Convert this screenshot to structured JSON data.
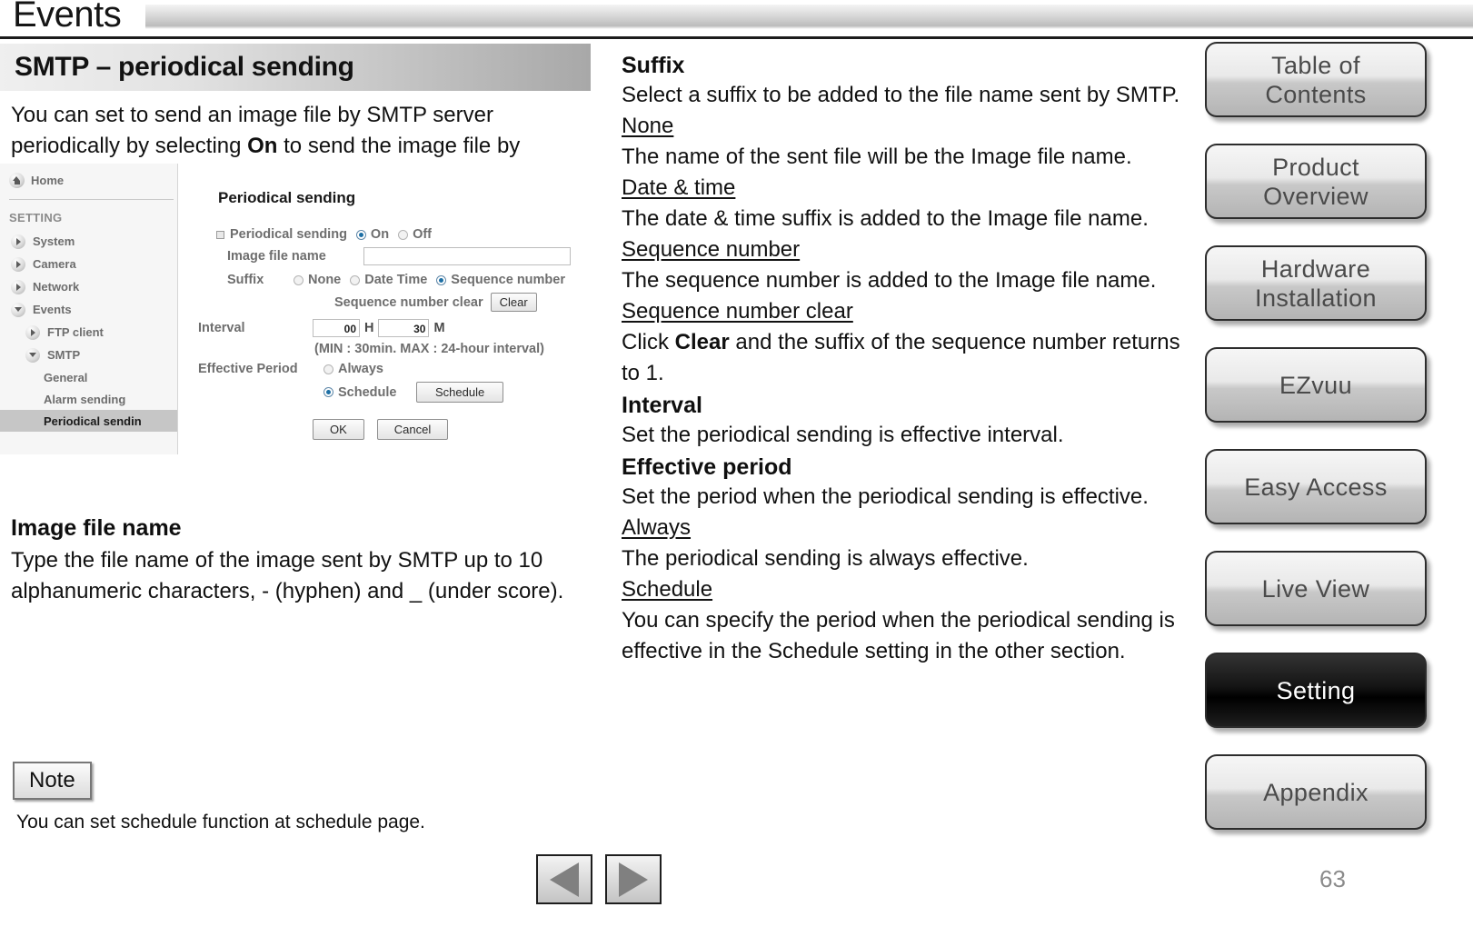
{
  "header": {
    "title": "Events"
  },
  "section": {
    "title": "SMTP – periodical sending",
    "intro_a": "You can set to send an image file by SMTP server periodically by selecting ",
    "intro_b": "On",
    "intro_c": " to send the image file by SMTP server linked with setting period."
  },
  "screenshot": {
    "nav": {
      "home_label": "Home",
      "group_label": "SETTING",
      "items": [
        {
          "label": "System",
          "icon": "chevron-right-icon",
          "level": 1,
          "selected": false
        },
        {
          "label": "Camera",
          "icon": "chevron-right-icon",
          "level": 1,
          "selected": false
        },
        {
          "label": "Network",
          "icon": "chevron-right-icon",
          "level": 1,
          "selected": false
        },
        {
          "label": "Events",
          "icon": "chevron-down-icon",
          "level": 1,
          "selected": false
        },
        {
          "label": "FTP client",
          "icon": "chevron-right-icon",
          "level": 2,
          "selected": false
        },
        {
          "label": "SMTP",
          "icon": "chevron-down-icon",
          "level": 2,
          "selected": false
        },
        {
          "label": "General",
          "icon": "none",
          "level": 3,
          "selected": false
        },
        {
          "label": "Alarm sending",
          "icon": "none",
          "level": 3,
          "selected": false
        },
        {
          "label": "Periodical sendin",
          "icon": "none",
          "level": 3,
          "selected": true
        }
      ]
    },
    "form": {
      "heading": "Periodical sending",
      "periodical_sending_label": "Periodical sending",
      "on_label": "On",
      "off_label": "Off",
      "periodical_sending_value": "On",
      "image_file_name_label": "Image file name",
      "image_file_name_value": "",
      "suffix_label": "Suffix",
      "suffix_none": "None",
      "suffix_datetime": "Date Time",
      "suffix_sequence": "Sequence number",
      "suffix_value": "Sequence number",
      "seq_clear_label": "Sequence number clear",
      "clear_button": "Clear",
      "interval_label": "Interval",
      "interval_hours": "00",
      "interval_hours_unit": "H",
      "interval_minutes": "30",
      "interval_minutes_unit": "M",
      "interval_hint": "(MIN : 30min. MAX : 24-hour interval)",
      "effective_period_label": "Effective Period",
      "always_label": "Always",
      "schedule_label": "Schedule",
      "effective_period_value": "Schedule",
      "schedule_button": "Schedule",
      "ok_button": "OK",
      "cancel_button": "Cancel"
    }
  },
  "left_lower": {
    "image_file_name_heading": "Image file name",
    "image_file_name_body": "Type the file name of the image sent by SMTP up to 10 alphanumeric characters, - (hyphen) and _ (under score).",
    "note_button": "Note",
    "note_text": "You can set schedule function at schedule page."
  },
  "right_col": {
    "blocks": [
      {
        "style": "bold",
        "text": "Suffix"
      },
      {
        "style": "plain",
        "text": "Select a suffix to be added to the file name sent by SMTP."
      },
      {
        "style": "underline",
        "text": "None"
      },
      {
        "style": "plain",
        "text": "The name of the sent file will be the Image file name."
      },
      {
        "style": "underline",
        "text": "Date & time"
      },
      {
        "style": "plain",
        "text": "The date & time suffix is added to the Image file name."
      },
      {
        "style": "underline",
        "text": "Sequence number"
      },
      {
        "style": "plain",
        "text": "The sequence number is added to the Image file name."
      },
      {
        "style": "underline",
        "text": "Sequence number clear"
      },
      {
        "style": "rich-clear",
        "text": "Click Clear and the suffix of the sequence number returns to 1."
      },
      {
        "style": "bold",
        "text": "Interval"
      },
      {
        "style": "plain",
        "text": "Set the periodical sending is effective interval."
      },
      {
        "style": "bold",
        "text": "Effective period"
      },
      {
        "style": "plain",
        "text": "Set the period when the periodical sending is effective."
      },
      {
        "style": "underline",
        "text": "Always"
      },
      {
        "style": "plain",
        "text": "The periodical sending is always effective."
      },
      {
        "style": "underline",
        "text": "Schedule"
      },
      {
        "style": "plain",
        "text": "You can specify the period when the periodical sending is effective in the Schedule setting in the other section."
      }
    ],
    "rich_clear": {
      "a": "Click ",
      "b": "Clear",
      "c": " and the suffix of the sequence number returns to 1."
    }
  },
  "side_nav": {
    "buttons": [
      {
        "line1": "Table of",
        "line2": "Contents",
        "active": false
      },
      {
        "line1": "Product",
        "line2": "Overview",
        "active": false
      },
      {
        "line1": "Hardware",
        "line2": "Installation",
        "active": false
      },
      {
        "line1": "EZvuu",
        "line2": "",
        "active": false
      },
      {
        "line1": "Easy Access",
        "line2": "",
        "active": false
      },
      {
        "line1": "Live View",
        "line2": "",
        "active": false
      },
      {
        "line1": "Setting",
        "line2": "",
        "active": true
      },
      {
        "line1": "Appendix",
        "line2": "",
        "active": false
      }
    ]
  },
  "footer": {
    "prev_label": "previous-page",
    "next_label": "next-page",
    "page_number": "63"
  }
}
